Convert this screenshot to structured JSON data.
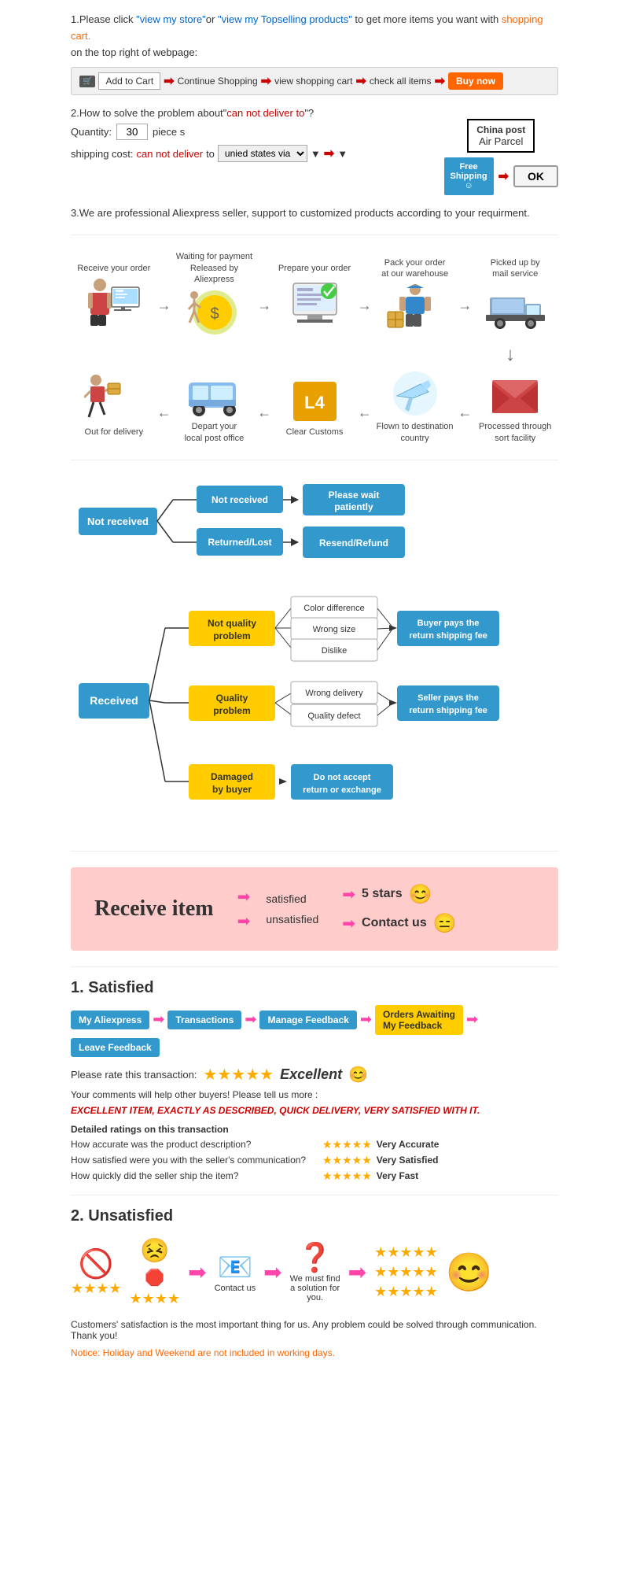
{
  "section1": {
    "text1": "1.Please click ",
    "link1": "\"view my store\"",
    "text2": "or ",
    "link2": "\"view my Topselling products\"",
    "text3": " to get more items you want with",
    "link3": "shopping cart.",
    "text4": "on the top right of webpage:",
    "steps": {
      "add": "Add to Cart",
      "continue": "Continue Shopping",
      "view": "view shopping cart",
      "check": "check all items",
      "buy": "Buy now"
    }
  },
  "section2": {
    "title": "2.How to solve the problem about",
    "problem": "\"can not deliver to\"",
    "text2": "?",
    "qty_label": "Quantity:",
    "qty_value": "30",
    "qty_unit": "piece s",
    "ship_label": "shipping cost:",
    "cant_deliver": "can not deliver",
    "to_label": "to",
    "ship_via": "unied states via",
    "china_post_title": "China post",
    "china_post_sub": "Air Parcel",
    "free_shipping": "Free\nShipping",
    "ok_label": "OK"
  },
  "section3": {
    "text": "3.We are professional Aliexpress seller, support to customized products according to your requirment."
  },
  "process_row1": {
    "items": [
      {
        "label": "Receive your order",
        "icon": "🧑‍💻"
      },
      {
        "label": "Waiting for payment\nReleased by Aliexpress",
        "icon": "💰"
      },
      {
        "label": "Prepare your order",
        "icon": "🖨️"
      },
      {
        "label": "Pack your order\nat our warehouse",
        "icon": "👷"
      },
      {
        "label": "Picked up by\nmail service",
        "icon": "🚚"
      }
    ]
  },
  "process_row2": {
    "items": [
      {
        "label": "Out for delivery",
        "icon": "🏃"
      },
      {
        "label": "Depart your\nlocal post office",
        "icon": "🚐"
      },
      {
        "label": "Clear Customs",
        "icon": "📦"
      },
      {
        "label": "Flown to destination\ncountry",
        "icon": "✈️"
      },
      {
        "label": "Processed through\nsort facility",
        "icon": "📮"
      }
    ]
  },
  "not_received": {
    "main_label": "Not received",
    "branch1_label": "Not received",
    "branch1_result": "Please wait\npatiently",
    "branch2_label": "Returned/Lost",
    "branch2_result": "Resend/Refund"
  },
  "received": {
    "main_label": "Received",
    "branch1": {
      "label": "Not quality\nproblem",
      "sub": [
        "Color difference",
        "Wrong size",
        "Dislike"
      ],
      "result": "Buyer pays the\nreturn shipping fee"
    },
    "branch2": {
      "label": "Quality\nproblem",
      "sub": [
        "Wrong delivery",
        "Quality defect"
      ],
      "result": "Seller pays the\nreturn shipping fee"
    },
    "branch3": {
      "label": "Damaged\nby buyer",
      "result": "Do not accept\nreturn or exchange"
    }
  },
  "receive_item": {
    "title": "Receive item",
    "row1_text": "satisfied",
    "row1_result": "5 stars",
    "row1_emoji": "😊",
    "row2_text": "unsatisfied",
    "row2_result": "Contact us",
    "row2_emoji": "😑"
  },
  "satisfied": {
    "title": "1. Satisfied",
    "steps": [
      "My Aliexpress",
      "Transactions",
      "Manage Feedback",
      "Orders Awaiting\nMy Feedback",
      "Leave Feedback"
    ],
    "rate_text": "Please rate this transaction:",
    "stars": "★★★★★",
    "excellent": "Excellent",
    "excellent_emoji": "😊",
    "comment1": "Your comments will help other buyers! Please tell us more :",
    "comment2": "EXCELLENT ITEM, EXACTLY AS DESCRIBED, QUICK DELIVERY, VERY SATISFIED WITH IT.",
    "detailed_title": "Detailed ratings on this transaction",
    "ratings": [
      {
        "label": "How accurate was the product description?",
        "stars": "★★★★★",
        "text": "Very Accurate"
      },
      {
        "label": "How satisfied were you with the seller's communication?",
        "stars": "★★★★★",
        "text": "Very Satisfied"
      },
      {
        "label": "How quickly did the seller ship the item?",
        "stars": "★★★★★",
        "text": "Very Fast"
      }
    ]
  },
  "unsatisfied": {
    "title": "2. Unsatisfied",
    "steps": [
      {
        "icon": "🚫\n⭐⭐⭐⭐",
        "label": ""
      },
      {
        "icon": "😣\n🛑",
        "label": ""
      },
      {
        "icon": "📧",
        "label": "Contact us"
      },
      {
        "icon": "❓",
        "label": "We must find\na solution for\nyou."
      }
    ],
    "notice1": "Customers' satisfaction is the most important thing for us. Any problem could be solved through communication. Thank you!",
    "notice2": "Notice: Holiday and Weekend are not included in working days."
  }
}
